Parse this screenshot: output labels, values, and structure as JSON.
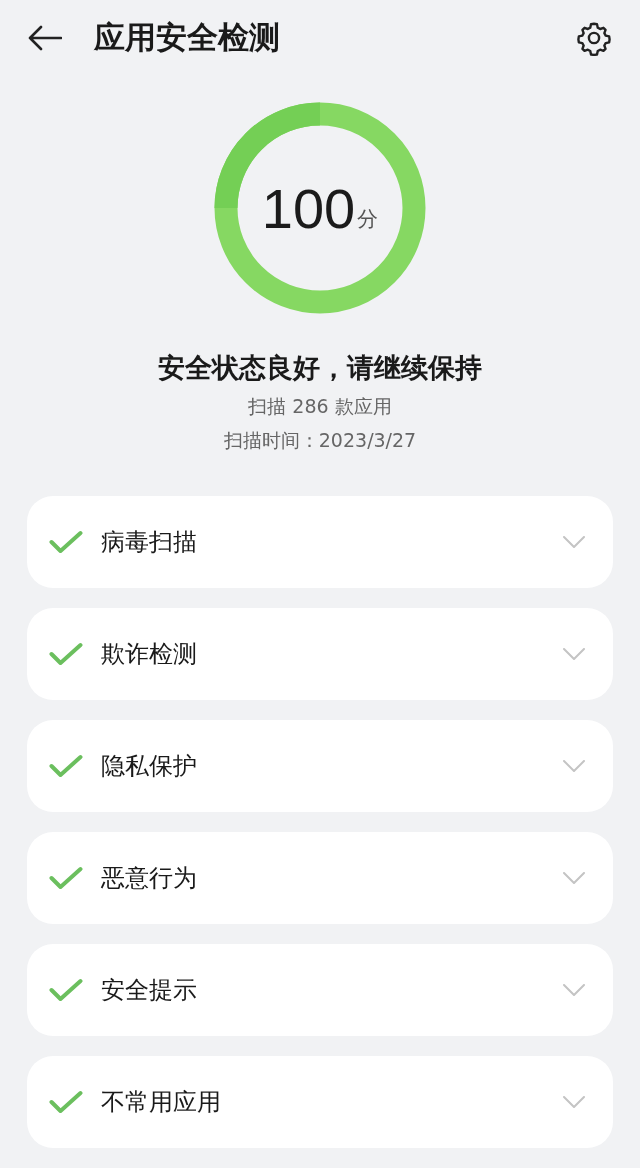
{
  "header": {
    "title": "应用安全检测"
  },
  "score": {
    "value": "100",
    "unit": "分"
  },
  "summary": {
    "status": "安全状态良好，请继续保持",
    "scanned": "扫描 286 款应用",
    "scan_time": "扫描时间：2023/3/27"
  },
  "checks": [
    {
      "label": "病毒扫描",
      "passed": true,
      "expanded": false
    },
    {
      "label": "欺诈检测",
      "passed": true,
      "expanded": false
    },
    {
      "label": "隐私保护",
      "passed": true,
      "expanded": false
    },
    {
      "label": "恶意行为",
      "passed": true,
      "expanded": false
    },
    {
      "label": "安全提示",
      "passed": true,
      "expanded": false
    },
    {
      "label": "不常用应用",
      "passed": true,
      "expanded": false
    }
  ]
}
